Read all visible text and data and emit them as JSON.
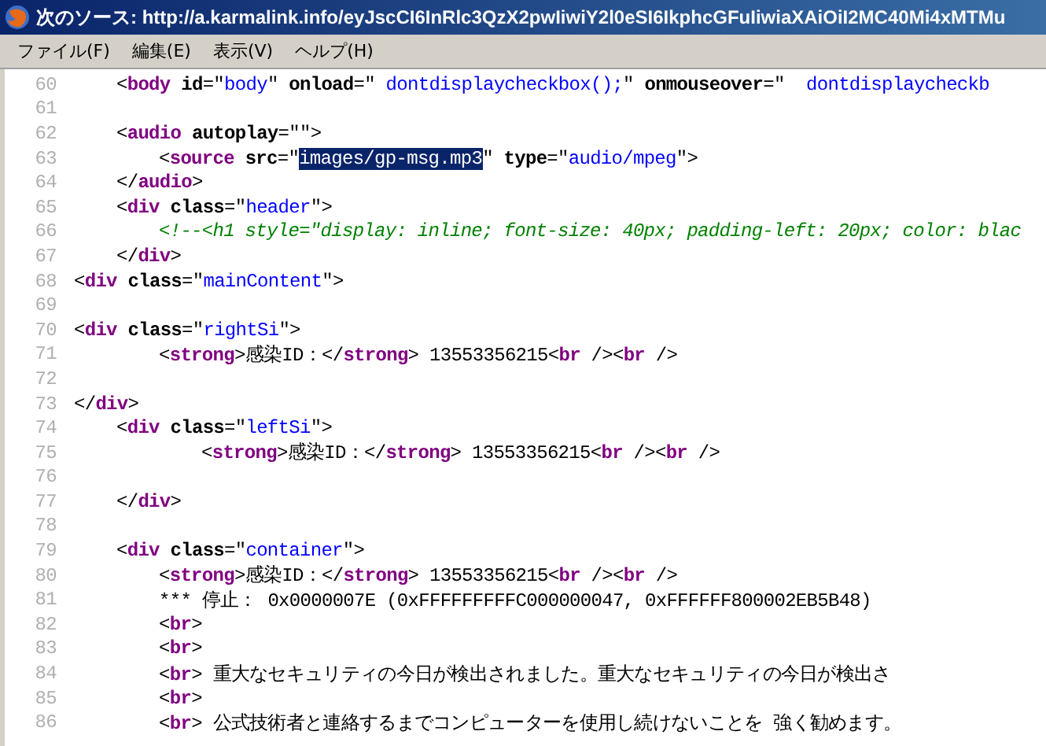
{
  "window": {
    "title": "次のソース: http://a.karmalink.info/eyJscCI6InRlc3QzX2pwIiwiY2l0eSI6IkphcGFuIiwiaXAiOiI2MC40Mi4xMTMu"
  },
  "menu": [
    "ファイル(F)",
    "編集(E)",
    "表示(V)",
    "ヘルプ(H)"
  ],
  "lines": [
    {
      "number": "60",
      "segments": [
        {
          "kind": "plain",
          "text": "\t<"
        },
        {
          "kind": "tag",
          "text": "body"
        },
        {
          "kind": "attr",
          "text": " id"
        },
        {
          "kind": "plain",
          "text": "=\""
        },
        {
          "kind": "value",
          "text": "body"
        },
        {
          "kind": "plain",
          "text": "\" "
        },
        {
          "kind": "attr",
          "text": "onload"
        },
        {
          "kind": "plain",
          "text": "=\""
        },
        {
          "kind": "value",
          "text": " dontdisplaycheckbox();"
        },
        {
          "kind": "plain",
          "text": "\" "
        },
        {
          "kind": "attr",
          "text": "onmouseover"
        },
        {
          "kind": "plain",
          "text": "=\""
        },
        {
          "kind": "value",
          "text": "  dontdisplaycheckb"
        }
      ]
    },
    {
      "number": "61"
    },
    {
      "number": "62",
      "segments": [
        {
          "kind": "plain",
          "text": "\t<"
        },
        {
          "kind": "tag",
          "text": "audio"
        },
        {
          "kind": "attr",
          "text": " autoplay"
        },
        {
          "kind": "plain",
          "text": "=\"\">"
        }
      ]
    },
    {
      "number": "63",
      "segments": [
        {
          "kind": "plain",
          "text": "\t\t<"
        },
        {
          "kind": "tag",
          "text": "source"
        },
        {
          "kind": "attr",
          "text": " src"
        },
        {
          "kind": "plain",
          "text": "=\""
        },
        {
          "kind": "selected",
          "text": "images/gp-msg.mp3"
        },
        {
          "kind": "plain",
          "text": "\" "
        },
        {
          "kind": "attr",
          "text": "type"
        },
        {
          "kind": "plain",
          "text": "=\""
        },
        {
          "kind": "value",
          "text": "audio/mpeg"
        },
        {
          "kind": "plain",
          "text": "\">"
        }
      ]
    },
    {
      "number": "64",
      "segments": [
        {
          "kind": "plain",
          "text": "\t</"
        },
        {
          "kind": "tag",
          "text": "audio"
        },
        {
          "kind": "plain",
          "text": ">"
        }
      ]
    },
    {
      "number": "65",
      "segments": [
        {
          "kind": "plain",
          "text": "\t<"
        },
        {
          "kind": "tag",
          "text": "div"
        },
        {
          "kind": "attr",
          "text": " class"
        },
        {
          "kind": "plain",
          "text": "=\""
        },
        {
          "kind": "value",
          "text": "header"
        },
        {
          "kind": "plain",
          "text": "\">"
        }
      ]
    },
    {
      "number": "66",
      "segments": [
        {
          "kind": "comment",
          "text": "\t\t<!--<h1 style=\"display: inline; font-size: 40px; padding-left: 20px; color: blac"
        }
      ]
    },
    {
      "number": "67",
      "segments": [
        {
          "kind": "plain",
          "text": "\t</"
        },
        {
          "kind": "tag",
          "text": "div"
        },
        {
          "kind": "plain",
          "text": ">"
        }
      ]
    },
    {
      "number": "68",
      "segments": [
        {
          "kind": "plain",
          "text": "<"
        },
        {
          "kind": "tag",
          "text": "div"
        },
        {
          "kind": "attr",
          "text": " class"
        },
        {
          "kind": "plain",
          "text": "=\""
        },
        {
          "kind": "value",
          "text": "mainContent"
        },
        {
          "kind": "plain",
          "text": "\">"
        }
      ]
    },
    {
      "number": "69"
    },
    {
      "number": "70",
      "segments": [
        {
          "kind": "plain",
          "text": "<"
        },
        {
          "kind": "tag",
          "text": "div"
        },
        {
          "kind": "attr",
          "text": " class"
        },
        {
          "kind": "plain",
          "text": "=\""
        },
        {
          "kind": "value",
          "text": "rightSi"
        },
        {
          "kind": "plain",
          "text": "\">"
        }
      ]
    },
    {
      "number": "71",
      "segments": [
        {
          "kind": "plain",
          "text": "\t\t<"
        },
        {
          "kind": "tag",
          "text": "strong"
        },
        {
          "kind": "plain",
          "text": ">感染ID：</"
        },
        {
          "kind": "tag",
          "text": "strong"
        },
        {
          "kind": "plain",
          "text": "> 13553356215<"
        },
        {
          "kind": "tag",
          "text": "br"
        },
        {
          "kind": "plain",
          "text": " /><"
        },
        {
          "kind": "tag",
          "text": "br"
        },
        {
          "kind": "plain",
          "text": " />"
        }
      ]
    },
    {
      "number": "72"
    },
    {
      "number": "73",
      "segments": [
        {
          "kind": "plain",
          "text": "</"
        },
        {
          "kind": "tag",
          "text": "div"
        },
        {
          "kind": "plain",
          "text": ">"
        }
      ]
    },
    {
      "number": "74",
      "segments": [
        {
          "kind": "plain",
          "text": "\t<"
        },
        {
          "kind": "tag",
          "text": "div"
        },
        {
          "kind": "attr",
          "text": " class"
        },
        {
          "kind": "plain",
          "text": "=\""
        },
        {
          "kind": "value",
          "text": "leftSi"
        },
        {
          "kind": "plain",
          "text": "\">"
        }
      ]
    },
    {
      "number": "75",
      "segments": [
        {
          "kind": "plain",
          "text": "\t\t\t<"
        },
        {
          "kind": "tag",
          "text": "strong"
        },
        {
          "kind": "plain",
          "text": ">感染ID：</"
        },
        {
          "kind": "tag",
          "text": "strong"
        },
        {
          "kind": "plain",
          "text": "> 13553356215<"
        },
        {
          "kind": "tag",
          "text": "br"
        },
        {
          "kind": "plain",
          "text": " /><"
        },
        {
          "kind": "tag",
          "text": "br"
        },
        {
          "kind": "plain",
          "text": " />"
        }
      ]
    },
    {
      "number": "76"
    },
    {
      "number": "77",
      "segments": [
        {
          "kind": "plain",
          "text": "\t</"
        },
        {
          "kind": "tag",
          "text": "div"
        },
        {
          "kind": "plain",
          "text": ">"
        }
      ]
    },
    {
      "number": "78"
    },
    {
      "number": "79",
      "segments": [
        {
          "kind": "plain",
          "text": "\t<"
        },
        {
          "kind": "tag",
          "text": "div"
        },
        {
          "kind": "attr",
          "text": " class"
        },
        {
          "kind": "plain",
          "text": "=\""
        },
        {
          "kind": "value",
          "text": "container"
        },
        {
          "kind": "plain",
          "text": "\">"
        }
      ]
    },
    {
      "number": "80",
      "segments": [
        {
          "kind": "plain",
          "text": "\t\t<"
        },
        {
          "kind": "tag",
          "text": "strong"
        },
        {
          "kind": "plain",
          "text": ">感染ID：</"
        },
        {
          "kind": "tag",
          "text": "strong"
        },
        {
          "kind": "plain",
          "text": "> 13553356215<"
        },
        {
          "kind": "tag",
          "text": "br"
        },
        {
          "kind": "plain",
          "text": " /><"
        },
        {
          "kind": "tag",
          "text": "br"
        },
        {
          "kind": "plain",
          "text": " />"
        }
      ]
    },
    {
      "number": "81",
      "segments": [
        {
          "kind": "plain",
          "text": "\t\t*** 停止： 0x0000007E (0xFFFFFFFFFC000000047, 0xFFFFFF800002EB5B48)"
        }
      ]
    },
    {
      "number": "82",
      "segments": [
        {
          "kind": "plain",
          "text": "\t\t<"
        },
        {
          "kind": "tag",
          "text": "br"
        },
        {
          "kind": "plain",
          "text": ">"
        }
      ]
    },
    {
      "number": "83",
      "segments": [
        {
          "kind": "plain",
          "text": "\t\t<"
        },
        {
          "kind": "tag",
          "text": "br"
        },
        {
          "kind": "plain",
          "text": ">"
        }
      ]
    },
    {
      "number": "84",
      "segments": [
        {
          "kind": "plain",
          "text": "\t\t<"
        },
        {
          "kind": "tag",
          "text": "br"
        },
        {
          "kind": "plain",
          "text": "> 重大なセキュリティの今日が検出されました。重大なセキュリティの今日が検出さ"
        }
      ]
    },
    {
      "number": "85",
      "segments": [
        {
          "kind": "plain",
          "text": "\t\t<"
        },
        {
          "kind": "tag",
          "text": "br"
        },
        {
          "kind": "plain",
          "text": ">"
        }
      ]
    },
    {
      "number": "86",
      "segments": [
        {
          "kind": "plain",
          "text": "\t\t<"
        },
        {
          "kind": "tag",
          "text": "br"
        },
        {
          "kind": "plain",
          "text": "> 公式技術者と連絡するまでコンピューターを使用し続けないことを 強く勧めます。"
        }
      ]
    }
  ]
}
